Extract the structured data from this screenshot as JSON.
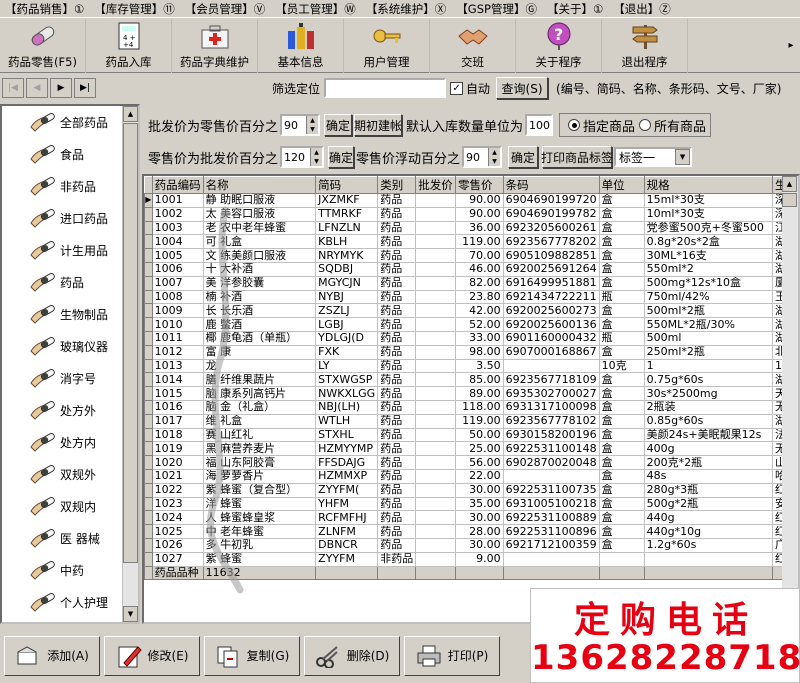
{
  "menubar": {
    "items": [
      "【药品销售】①",
      "【库存管理】⑪",
      "【会员管理】Ⓥ",
      "【员工管理】Ⓦ",
      "【系统维护】Ⓧ",
      "【GSP管理】Ⓖ",
      "【关于】①",
      "【退出】Ⓩ"
    ]
  },
  "toolbar": {
    "items": [
      {
        "label": "药品零售(F5)",
        "icon": "capsule-icon"
      },
      {
        "label": "药品入库",
        "icon": "calculator-icon"
      },
      {
        "label": "药品字典维护",
        "icon": "medicine-kit-icon"
      },
      {
        "label": "基本信息",
        "icon": "bottles-icon"
      },
      {
        "label": "用户管理",
        "icon": "keys-icon"
      },
      {
        "label": "交班",
        "icon": "handshake-icon"
      },
      {
        "label": "关于程序",
        "icon": "question-icon"
      },
      {
        "label": "退出程序",
        "icon": "signpost-icon"
      }
    ],
    "more": "▸"
  },
  "navbar": {
    "buttons": [
      "|◀",
      "◀",
      "▶",
      "▶|"
    ],
    "filter_label": "筛选定位",
    "filter_value": "",
    "auto_checkbox": "自动",
    "auto_checked": "✓",
    "query_button": "查询(S)",
    "hint": "(编号、简码、名称、条形码、文号、厂家)"
  },
  "sidebar": {
    "items": [
      "全部药品",
      "食品",
      "非药品",
      "进口药品",
      "计生用品",
      "药品",
      "生物制品",
      "玻璃仪器",
      "消字号",
      "处方外",
      "处方内",
      "双规外",
      "双规内",
      "医  器械",
      "中药",
      "个人护理"
    ]
  },
  "params": {
    "wholesale_label": "批发价为零售价百分之",
    "wholesale_value": "90",
    "confirm1": "确定",
    "opening_button": "期初建帐",
    "default_qty_label": "默认入库数量单位为",
    "default_qty_value": "100",
    "radio_specified": "指定商品",
    "radio_all": "所有商品",
    "retail_label": "零售价为批发价百分之",
    "retail_value": "120",
    "confirm2": "确定",
    "float_label": "零售价浮动百分之",
    "float_value": "90",
    "confirm3": "确定",
    "print_label_button": "打印商品标签",
    "label_select": "标签一"
  },
  "grid": {
    "columns": [
      "药品编码",
      "名称",
      "简码",
      "类别",
      "批发价",
      "零售价",
      "条码",
      "单位",
      "规格",
      "生"
    ],
    "rows": [
      [
        "1001",
        "静  助眠口服液",
        "JXZMKF",
        "药品",
        "",
        "90.00",
        "6904690199720",
        "盒",
        "15ml*30支",
        "深"
      ],
      [
        "1002",
        "太  美容口服液",
        "TTMRKF",
        "药品",
        "",
        "90.00",
        "6904690199782",
        "盒",
        "10ml*30支",
        "深"
      ],
      [
        "1003",
        "老  农中老年蜂蜜",
        "LFNZLN",
        "药品",
        "",
        "36.00",
        "6923205600261",
        "盒",
        "党参蜜500克+冬蜜500",
        "江"
      ],
      [
        "1004",
        "可  礼盒",
        "KBLH",
        "药品",
        "",
        "119.00",
        "6923567778202",
        "盒",
        "0.8g*20s*2盒",
        "湖"
      ],
      [
        "1005",
        "文  练美颜口服液",
        "NRYMYK",
        "药品",
        "",
        "70.00",
        "6905109882851",
        "盒",
        "30ML*16支",
        "湖"
      ],
      [
        "1006",
        "十  大补酒",
        "SQDBJ",
        "药品",
        "",
        "46.00",
        "6920025691264",
        "盒",
        "550ml*2",
        "湖"
      ],
      [
        "1007",
        "美  洋参胶囊",
        "MGYCJN",
        "药品",
        "",
        "82.00",
        "6916499951881",
        "盒",
        "500mg*12s*10盒",
        "厦"
      ],
      [
        "1008",
        "楠  补酒",
        "NYBJ",
        "药品",
        "",
        "23.80",
        "6921434722211",
        "瓶",
        "750ml/42%",
        "玉"
      ],
      [
        "1009",
        "长  长乐酒",
        "ZSZLJ",
        "药品",
        "",
        "42.00",
        "6920025600273",
        "盒",
        "500ml*2瓶",
        "湖"
      ],
      [
        "1010",
        "鹿  鳖酒",
        "LGBJ",
        "药品",
        "",
        "52.00",
        "6920025600136",
        "盒",
        "550ML*2瓶/30%",
        "湖"
      ],
      [
        "1011",
        "椰  鹿龟酒（单瓶）",
        "YDLGJ(D",
        "药品",
        "",
        "33.00",
        "6901160000432",
        "瓶",
        "500ml",
        "湖"
      ],
      [
        "1012",
        "富  康",
        "FXK",
        "药品",
        "",
        "98.00",
        "6907000168867",
        "盒",
        "250ml*2瓶",
        "北"
      ],
      [
        "1013",
        "龙  ",
        "LY",
        "药品",
        "",
        "3.50",
        "",
        "10克",
        "1",
        "1"
      ],
      [
        "1014",
        "膳  纤维果蔬片",
        "STXWGSP",
        "药品",
        "",
        "85.00",
        "6923567718109",
        "盒",
        "0.75g*60s",
        "湖"
      ],
      [
        "1015",
        "脑  康系列高钙片",
        "NWKXLGG",
        "药品",
        "",
        "89.00",
        "6935302700027",
        "盒",
        "30s*2500mg",
        "天"
      ],
      [
        "1016",
        "脑  金（礼盒）",
        "NBJ(LH)",
        "药品",
        "",
        "118.00",
        "6931317100098",
        "盒",
        "2瓶装",
        "无"
      ],
      [
        "1017",
        "维  礼盒",
        "WTLH",
        "药品",
        "",
        "119.00",
        "6923567778102",
        "盒",
        "0.85g*60s",
        "湖"
      ],
      [
        "1018",
        "赛  山红礼",
        "STXHL",
        "药品",
        "",
        "50.00",
        "6930158200196",
        "盒",
        "美颜24s+美眠靓果12s",
        "法"
      ],
      [
        "1019",
        "黑  麻营养麦片",
        "HZMYYMP",
        "药品",
        "",
        "25.00",
        "6922531100148",
        "盒",
        "400g",
        "无"
      ],
      [
        "1020",
        "福  山东阿胶膏",
        "FFSDAJG",
        "药品",
        "",
        "56.00",
        "6902870020048",
        "盒",
        "200克*2瓶",
        "山"
      ],
      [
        "1021",
        "海  萝萝香片",
        "HZMMXP",
        "药品",
        "",
        "22.00",
        "",
        "盒",
        "48s",
        "哈"
      ],
      [
        "1022",
        "紫  蜂蜜（复合型）",
        "ZYYFM(",
        "药品",
        "",
        "30.00",
        "6922531100735",
        "盒",
        "280g*3瓶",
        "红"
      ],
      [
        "1023",
        "洋  蜂蜜",
        "YHFM",
        "药品",
        "",
        "35.00",
        "6931005100218",
        "盒",
        "500g*2瓶",
        "安"
      ],
      [
        "1024",
        "人  蜂蜜蜂皇浆",
        "RCFMFHJ",
        "药品",
        "",
        "30.00",
        "6922531100889",
        "盒",
        "440g",
        "红"
      ],
      [
        "1025",
        "中  老年蜂蜜",
        "ZLNFM",
        "药品",
        "",
        "28.00",
        "6922531100896",
        "盒",
        "440g*10g",
        "红"
      ],
      [
        "1026",
        "多  牛初乳",
        "DBNCR",
        "药品",
        "",
        "30.00",
        "6921712100359",
        "盒",
        "1.2g*60s",
        "广"
      ],
      [
        "1027",
        "紫  蜂蜜",
        "ZYYFM",
        "非药品",
        "",
        "9.00",
        "",
        "",
        "",
        "红"
      ]
    ],
    "footer_label": "药品品种",
    "footer_value": "11632"
  },
  "bottombar": {
    "buttons": [
      {
        "label": "添加(A)",
        "icon": "add-icon"
      },
      {
        "label": "修改(E)",
        "icon": "edit-icon"
      },
      {
        "label": "复制(G)",
        "icon": "copy-icon"
      },
      {
        "label": "删除(D)",
        "icon": "scissors-icon"
      },
      {
        "label": "打印(P)",
        "icon": "printer-icon"
      }
    ]
  },
  "promo": {
    "title": "定购电话",
    "phone": "13628228718"
  },
  "colors": {
    "window_bg": "#d4d0c8",
    "promo_red": "#e60012"
  }
}
